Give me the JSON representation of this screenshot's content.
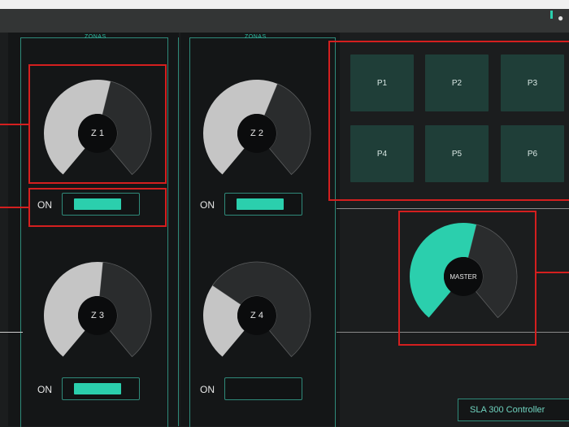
{
  "header": {
    "icon": "eye-icon"
  },
  "zones": {
    "title_left": "ZONAS",
    "title_right": "ZONAS",
    "items": [
      {
        "label": "Z 1",
        "level": 0.55,
        "toggle_label": "ON",
        "toggle_on": true
      },
      {
        "label": "Z 2",
        "level": 0.58,
        "toggle_label": "ON",
        "toggle_on": true
      },
      {
        "label": "Z 3",
        "level": 0.52,
        "toggle_label": "ON",
        "toggle_on": true
      },
      {
        "label": "Z 4",
        "level": 0.3,
        "toggle_label": "ON",
        "toggle_on": false
      }
    ]
  },
  "presets": {
    "items": [
      "P1",
      "P2",
      "P3",
      "P4",
      "P5",
      "P6"
    ]
  },
  "master": {
    "label": "MASTER",
    "level": 0.55
  },
  "status": {
    "text": "SLA 300 Controller"
  },
  "colors": {
    "accent": "#2bcfad",
    "knob_fill": "#c5c5c5",
    "knob_track": "#2a2c2d",
    "preset_bg": "#1f3e38",
    "annotation": "#d41f1f"
  }
}
